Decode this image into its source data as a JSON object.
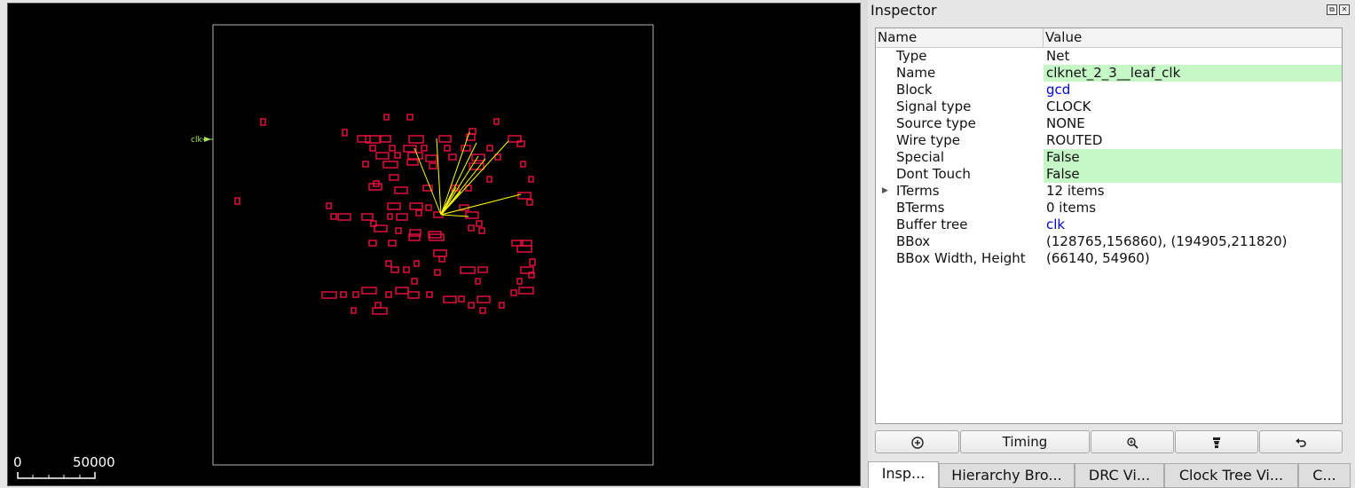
{
  "layout_view": {
    "pin_label": "clk",
    "scale_start": "0",
    "scale_end": "50000",
    "colors": {
      "background": "#000000",
      "die": "#b4b4b4",
      "cell": "#e0103c",
      "flyline": "#ffff00",
      "pin": "#a6e05a"
    }
  },
  "inspector": {
    "title": "Inspector",
    "columns": {
      "name": "Name",
      "value": "Value"
    },
    "rows": [
      {
        "name": "Type",
        "value": "Net"
      },
      {
        "name": "Name",
        "value": "clknet_2_3__leaf_clk"
      },
      {
        "name": "Block",
        "value": "gcd"
      },
      {
        "name": "Signal type",
        "value": "CLOCK"
      },
      {
        "name": "Source type",
        "value": "NONE"
      },
      {
        "name": "Wire type",
        "value": "ROUTED"
      },
      {
        "name": "Special",
        "value": "False"
      },
      {
        "name": "Dont Touch",
        "value": "False"
      },
      {
        "name": "ITerms",
        "value": "12 items"
      },
      {
        "name": "BTerms",
        "value": "0 items"
      },
      {
        "name": "Buffer tree",
        "value": "clk"
      },
      {
        "name": "BBox",
        "value": "(128765,156860), (194905,211820)"
      },
      {
        "name": "BBox Width, Height",
        "value": "(66140, 54960)"
      }
    ],
    "buttons": {
      "timing": "Timing"
    },
    "icons": {
      "focus": "focus-zoom-icon",
      "zoom": "zoom-in-icon",
      "highlight": "highlight-icon",
      "back": "undo-icon"
    }
  },
  "tabs": [
    {
      "label": "Insp..."
    },
    {
      "label": "Hierarchy Bro..."
    },
    {
      "label": "DRC Vi..."
    },
    {
      "label": "Clock Tree Vi..."
    },
    {
      "label": "C..."
    }
  ]
}
